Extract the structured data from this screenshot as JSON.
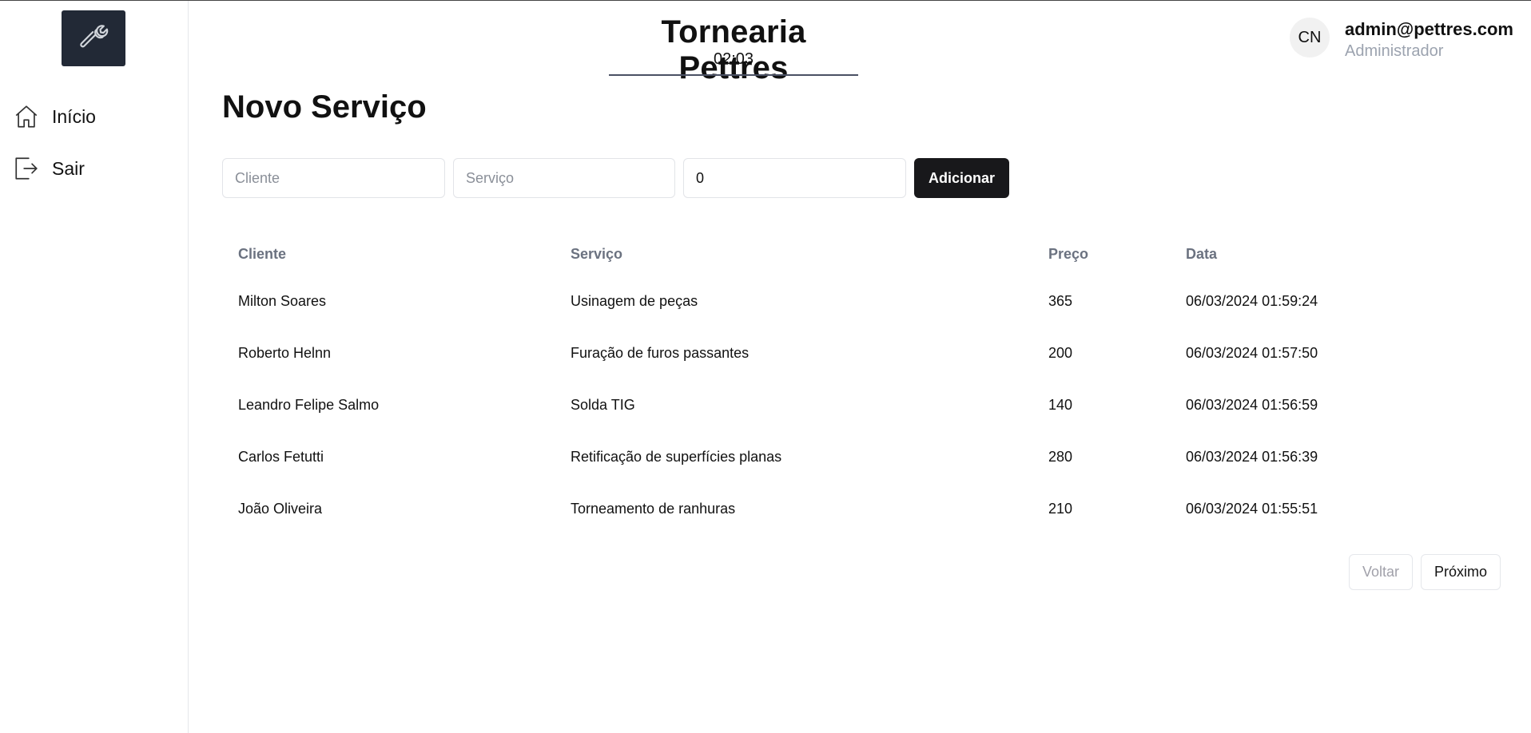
{
  "app": {
    "title": "Tornearia Pettres",
    "clock": "02:03"
  },
  "sidebar": {
    "logo_icon": "wrench-icon",
    "items": [
      {
        "label": "Início",
        "icon": "home-icon"
      },
      {
        "label": "Sair",
        "icon": "logout-icon"
      }
    ]
  },
  "user": {
    "initials": "CN",
    "email": "admin@pettres.com",
    "role": "Administrador"
  },
  "page": {
    "title": "Novo Serviço"
  },
  "form": {
    "client_placeholder": "Cliente",
    "service_placeholder": "Serviço",
    "price_value": "0",
    "add_label": "Adicionar"
  },
  "table": {
    "headers": [
      "Cliente",
      "Serviço",
      "Preço",
      "Data"
    ],
    "rows": [
      [
        "Milton Soares",
        "Usinagem de peças",
        "365",
        "06/03/2024 01:59:24"
      ],
      [
        "Roberto Helnn",
        "Furação de furos passantes",
        "200",
        "06/03/2024 01:57:50"
      ],
      [
        "Leandro Felipe Salmo",
        "Solda TIG",
        "140",
        "06/03/2024 01:56:59"
      ],
      [
        "Carlos Fetutti",
        "Retificação de superfícies planas",
        "280",
        "06/03/2024 01:56:39"
      ],
      [
        "João Oliveira",
        "Torneamento de ranhuras",
        "210",
        "06/03/2024 01:55:51"
      ]
    ]
  },
  "pagination": {
    "prev_label": "Voltar",
    "next_label": "Próximo"
  },
  "colors": {
    "logo_bg": "#222936",
    "primary_button": "#18181b",
    "muted_text": "#9ca3af"
  }
}
